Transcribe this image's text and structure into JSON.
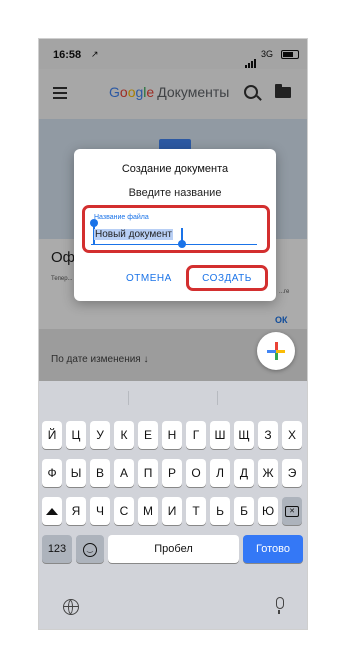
{
  "status_bar": {
    "time": "16:58",
    "location_arrow": "↗",
    "network": "3G"
  },
  "app_bar": {
    "logo_letters": [
      "G",
      "o",
      "o",
      "g",
      "l",
      "e"
    ],
    "app_name": "Документы"
  },
  "background": {
    "card_title": "Оф",
    "card_text": "Тепер... Можн...",
    "card_right": "...ге",
    "card_ok": "ОК",
    "sort_label": "По дате изменения ↓"
  },
  "dialog": {
    "title": "Создание документа",
    "subtitle": "Введите название",
    "field_label": "Название файла",
    "field_value": "Новый документ",
    "cancel_label": "ОТМЕНА",
    "create_label": "СОЗДАТЬ"
  },
  "keyboard": {
    "row1": [
      "Й",
      "Ц",
      "У",
      "К",
      "Е",
      "Н",
      "Г",
      "Ш",
      "Щ",
      "З",
      "Х"
    ],
    "row2": [
      "Ф",
      "Ы",
      "В",
      "А",
      "П",
      "Р",
      "О",
      "Л",
      "Д",
      "Ж",
      "Э"
    ],
    "row3": [
      "Я",
      "Ч",
      "С",
      "М",
      "И",
      "Т",
      "Ь",
      "Б",
      "Ю"
    ],
    "numbers_label": "123",
    "space_label": "Пробел",
    "done_label": "Готово"
  },
  "colors": {
    "accent": "#1a73e8",
    "highlight_box": "#d32f2f",
    "done_key": "#3478f6"
  },
  "icons": [
    "menu-icon",
    "search-icon",
    "folder-icon",
    "plus-icon",
    "shift-icon",
    "backspace-icon",
    "emoji-icon",
    "globe-icon",
    "mic-icon"
  ]
}
